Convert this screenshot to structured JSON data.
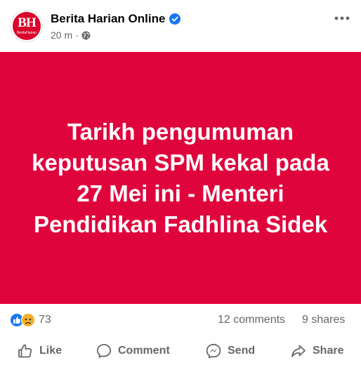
{
  "post": {
    "page_name": "Berita Harian Online",
    "avatar_text": "BH",
    "avatar_subtext": "BeritaHarian",
    "time": "20 m",
    "meta_separator": "·",
    "headline": "Tarikh pengumuman keputusan SPM kekal pada 27 Mei ini - Menteri Pendidikan Fadhlina Sidek"
  },
  "stats": {
    "reaction_count": "73",
    "comments": "12 comments",
    "shares": "9 shares"
  },
  "actions": {
    "like": "Like",
    "comment": "Comment",
    "send": "Send",
    "share": "Share"
  },
  "icons": {
    "verified": "verified-badge-icon",
    "privacy": "globe-icon",
    "more": "more-options-icon",
    "reactions": [
      "like-reaction-icon",
      "sad-reaction-icon"
    ]
  },
  "colors": {
    "image_background": "#e0043d",
    "brand_red": "#d9042b",
    "verified_blue": "#1877f2",
    "secondary_text": "#65676b"
  }
}
